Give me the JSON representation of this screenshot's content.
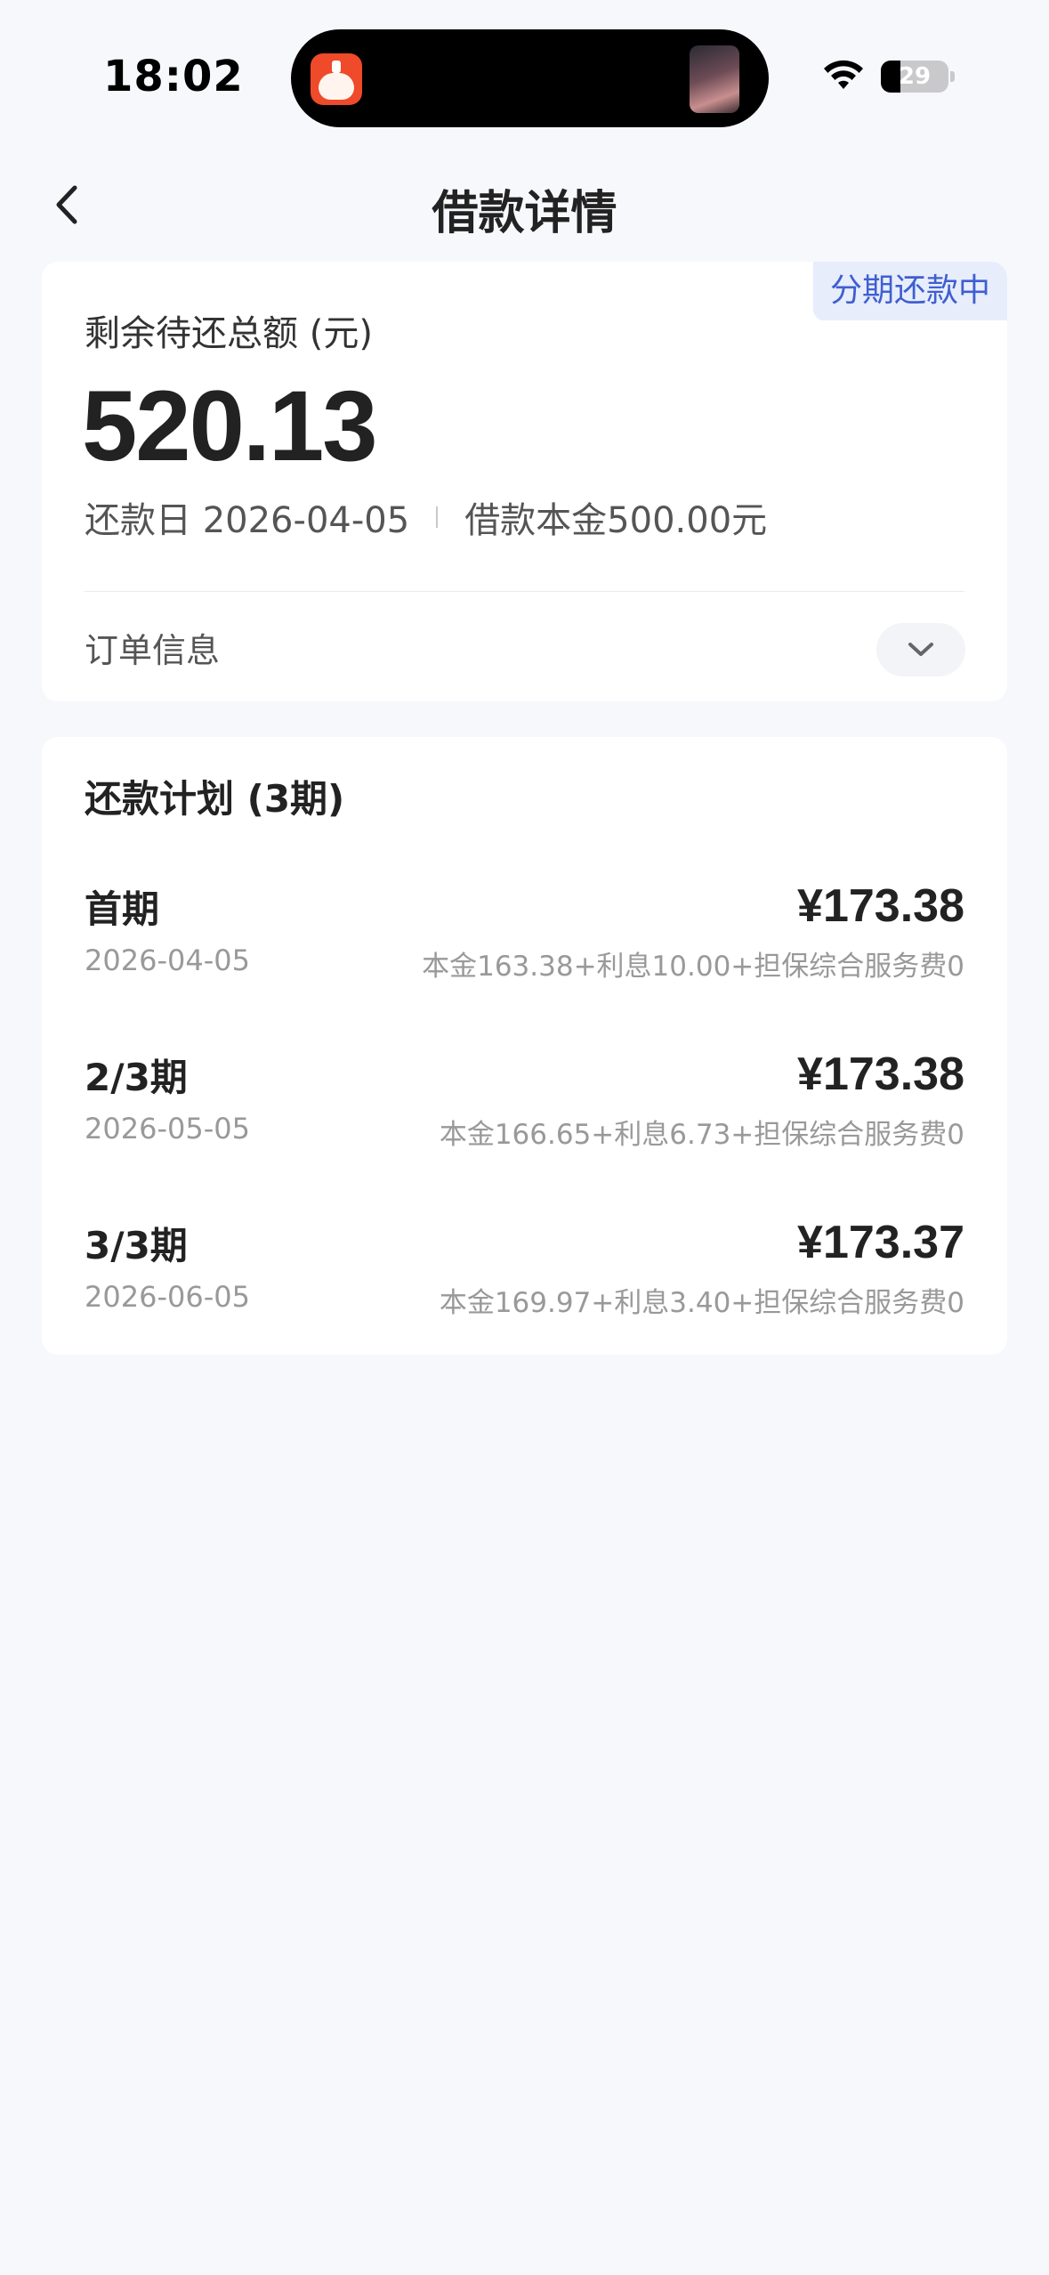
{
  "status_bar": {
    "time": "18:02",
    "battery_level": "29",
    "battery_fraction": 0.29
  },
  "nav": {
    "title": "借款详情",
    "back_icon": "chevron-left-icon"
  },
  "summary": {
    "badge": "分期还款中",
    "remaining_label": "剩余待还总额 (元)",
    "remaining_amount": "520.13",
    "due_date": "还款日 2026-04-05",
    "principal": "借款本金500.00元",
    "order_info_label": "订单信息",
    "expand_icon": "chevron-down-icon"
  },
  "plan": {
    "title": "还款计划 (3期)",
    "items": [
      {
        "label": "首期",
        "date": "2026-04-05",
        "amount": "¥173.38",
        "breakdown": "本金163.38+利息10.00+担保综合服务费0"
      },
      {
        "label": "2/3期",
        "date": "2026-05-05",
        "amount": "¥173.38",
        "breakdown": "本金166.65+利息6.73+担保综合服务费0"
      },
      {
        "label": "3/3期",
        "date": "2026-06-05",
        "amount": "¥173.37",
        "breakdown": "本金169.97+利息3.40+担保综合服务费0"
      }
    ]
  },
  "colors": {
    "background": "#f7f8fc",
    "badge_bg": "#e8edfc",
    "badge_text": "#3f5fd0"
  }
}
